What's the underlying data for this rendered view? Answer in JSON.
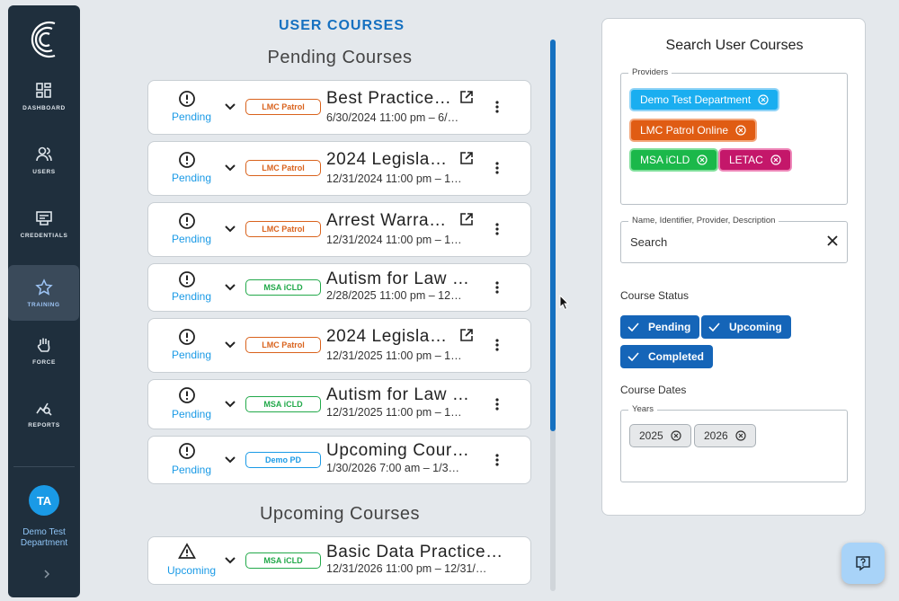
{
  "sidebar": {
    "items": [
      {
        "label": "DASHBOARD",
        "icon": "dashboard-icon"
      },
      {
        "label": "USERS",
        "icon": "users-icon"
      },
      {
        "label": "CREDENTIALS",
        "icon": "credentials-icon"
      },
      {
        "label": "TRAINING",
        "icon": "star-icon"
      },
      {
        "label": "FORCE",
        "icon": "hand-icon"
      },
      {
        "label": "REPORTS",
        "icon": "reports-icon"
      }
    ],
    "active": "TRAINING",
    "avatar_initials": "TA",
    "department": "Demo Test Department"
  },
  "main": {
    "title": "USER COURSES",
    "pending_heading": "Pending Courses",
    "upcoming_heading": "Upcoming Courses",
    "pending_courses": [
      {
        "status": "Pending",
        "provider": "LMC Patrol",
        "title": "Best Practice…",
        "dates": "6/30/2024 11:00 pm – 6/…"
      },
      {
        "status": "Pending",
        "provider": "LMC Patrol",
        "title": "2024 Legisla…",
        "dates": "12/31/2024 11:00 pm – 1…"
      },
      {
        "status": "Pending",
        "provider": "LMC Patrol",
        "title": "Arrest Warra…",
        "dates": "12/31/2024 11:00 pm – 1…"
      },
      {
        "status": "Pending",
        "provider": "MSA iCLD",
        "title": "Autism for Law …",
        "dates": "2/28/2025 11:00 pm – 12…"
      },
      {
        "status": "Pending",
        "provider": "LMC Patrol",
        "title": "2024 Legisla…",
        "dates": "12/31/2025 11:00 pm – 1…"
      },
      {
        "status": "Pending",
        "provider": "MSA iCLD",
        "title": "Autism for Law …",
        "dates": "12/31/2025 11:00 pm – 1…"
      },
      {
        "status": "Pending",
        "provider": "Demo PD",
        "title": "Upcoming Cour…",
        "dates": "1/30/2026 7:00 am – 1/3…"
      }
    ],
    "upcoming_courses": [
      {
        "status": "Upcoming",
        "provider": "MSA iCLD",
        "title": "Basic Data Practice…",
        "dates": "12/31/2026 11:00 pm – 12/31/…"
      }
    ]
  },
  "search": {
    "title": "Search User Courses",
    "providers_label": "Providers",
    "providers": [
      "Demo Test Department",
      "LMC Patrol Online",
      "MSA iCLD",
      "LETAC"
    ],
    "search_label": "Name, Identifier, Provider, Description",
    "search_placeholder": "Search",
    "status_label": "Course Status",
    "statuses": [
      "Pending",
      "Upcoming",
      "Completed"
    ],
    "dates_label": "Course Dates",
    "years_label": "Years",
    "years": [
      "2025",
      "2026"
    ]
  },
  "colors": {
    "sidebar": "#1f2f3d",
    "accent": "#1570c0",
    "pending": "#1a9ae6",
    "lmc": "#d9621c",
    "msa": "#22a94a"
  }
}
